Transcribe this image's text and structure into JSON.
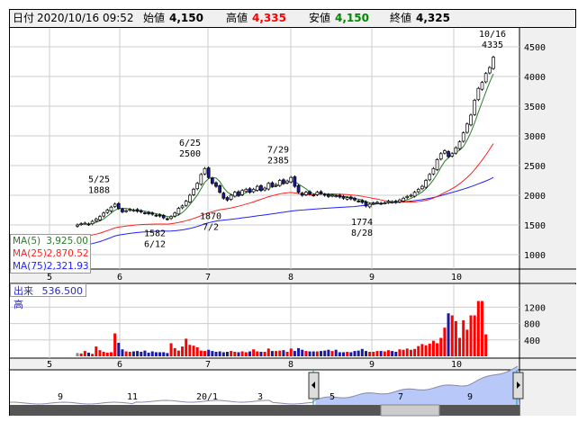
{
  "header": {
    "date_label": "日付",
    "date": "2020/10/16 09:52",
    "open_label": "始値",
    "open": "4,150",
    "high_label": "高値",
    "high": "4,335",
    "low_label": "安値",
    "low": "4,150",
    "close_label": "終値",
    "close": "4,325"
  },
  "legend": {
    "ma5_label": "MA(5)",
    "ma5": "3,925.00",
    "ma25_label": "MA(25)",
    "ma25": "2,870.52",
    "ma75_label": "MA(75)",
    "ma75": "2,321.93"
  },
  "volume_panel": {
    "label": "出来高",
    "value": "536.500"
  },
  "colors": {
    "up": "#ff0000",
    "down": "#1a1aa0",
    "ma5": "#2a7a2a",
    "ma25": "#ff2020",
    "ma75": "#2020ff"
  },
  "chart_data": {
    "type": "candlestick",
    "price_ticks": [
      "4500",
      "4000",
      "3500",
      "3000",
      "2500",
      "2000",
      "1500",
      "1000"
    ],
    "price_tick_values": [
      4500,
      4000,
      3500,
      3000,
      2500,
      2000,
      1500,
      1000
    ],
    "volume_ticks": [
      "1200",
      "800",
      "400"
    ],
    "volume_tick_values": [
      1200,
      800,
      400
    ],
    "month_labels": [
      "5",
      "6",
      "7",
      "8",
      "9",
      "10"
    ],
    "annotations": [
      {
        "date": "5/25",
        "price": "1888",
        "pos": "above"
      },
      {
        "date": "6/12",
        "price": "1582",
        "pos": "below"
      },
      {
        "date": "6/25",
        "price": "2500",
        "pos": "above"
      },
      {
        "date": "7/2",
        "price": "1870",
        "pos": "below"
      },
      {
        "date": "7/29",
        "price": "2385",
        "pos": "above"
      },
      {
        "date": "8/28",
        "price": "1774",
        "pos": "below"
      },
      {
        "date": "10/16",
        "price": "4335",
        "pos": "above"
      }
    ],
    "closes": [
      1500,
      1520,
      1530,
      1510,
      1560,
      1600,
      1640,
      1700,
      1750,
      1800,
      1850,
      1780,
      1720,
      1740,
      1760,
      1750,
      1730,
      1720,
      1700,
      1690,
      1680,
      1660,
      1650,
      1620,
      1600,
      1640,
      1700,
      1780,
      1820,
      1900,
      2000,
      2100,
      2200,
      2350,
      2450,
      2300,
      2200,
      2150,
      2050,
      1950,
      1920,
      2000,
      2050,
      2000,
      2080,
      2100,
      2050,
      2100,
      2150,
      2080,
      2120,
      2200,
      2150,
      2180,
      2250,
      2200,
      2240,
      2300,
      2150,
      2050,
      2000,
      2050,
      2020,
      2000,
      2050,
      2030,
      2000,
      1980,
      2000,
      1990,
      1970,
      1950,
      1960,
      1940,
      1920,
      1900,
      1880,
      1820,
      1850,
      1870,
      1880,
      1860,
      1870,
      1900,
      1890,
      1880,
      1920,
      1950,
      1980,
      2000,
      2050,
      2100,
      2150,
      2250,
      2350,
      2450,
      2600,
      2700,
      2750,
      2650,
      2700,
      2800,
      2900,
      3050,
      3200,
      3350,
      3600,
      3800,
      3900,
      4050,
      4150,
      4325
    ],
    "volumes": [
      80,
      70,
      130,
      90,
      60,
      240,
      150,
      110,
      90,
      100,
      560,
      330,
      170,
      120,
      110,
      120,
      130,
      110,
      140,
      90,
      120,
      100,
      100,
      100,
      80,
      320,
      200,
      140,
      240,
      430,
      280,
      260,
      220,
      140,
      130,
      160,
      130,
      110,
      120,
      100,
      110,
      130,
      110,
      100,
      120,
      100,
      120,
      170,
      120,
      110,
      110,
      190,
      130,
      130,
      140,
      150,
      110,
      190,
      130,
      200,
      160,
      130,
      120,
      120,
      120,
      130,
      140,
      160,
      130,
      160,
      100,
      100,
      110,
      100,
      130,
      140,
      180,
      130,
      110,
      110,
      130,
      130,
      120,
      150,
      130,
      110,
      170,
      160,
      190,
      160,
      180,
      250,
      300,
      270,
      310,
      380,
      320,
      450,
      700,
      1050,
      1000,
      860,
      450,
      880,
      650,
      1000,
      1000,
      1350,
      1350,
      536
    ],
    "navigator_labels": [
      "9",
      "11",
      "20/1",
      "3",
      "5",
      "7",
      "9"
    ]
  }
}
